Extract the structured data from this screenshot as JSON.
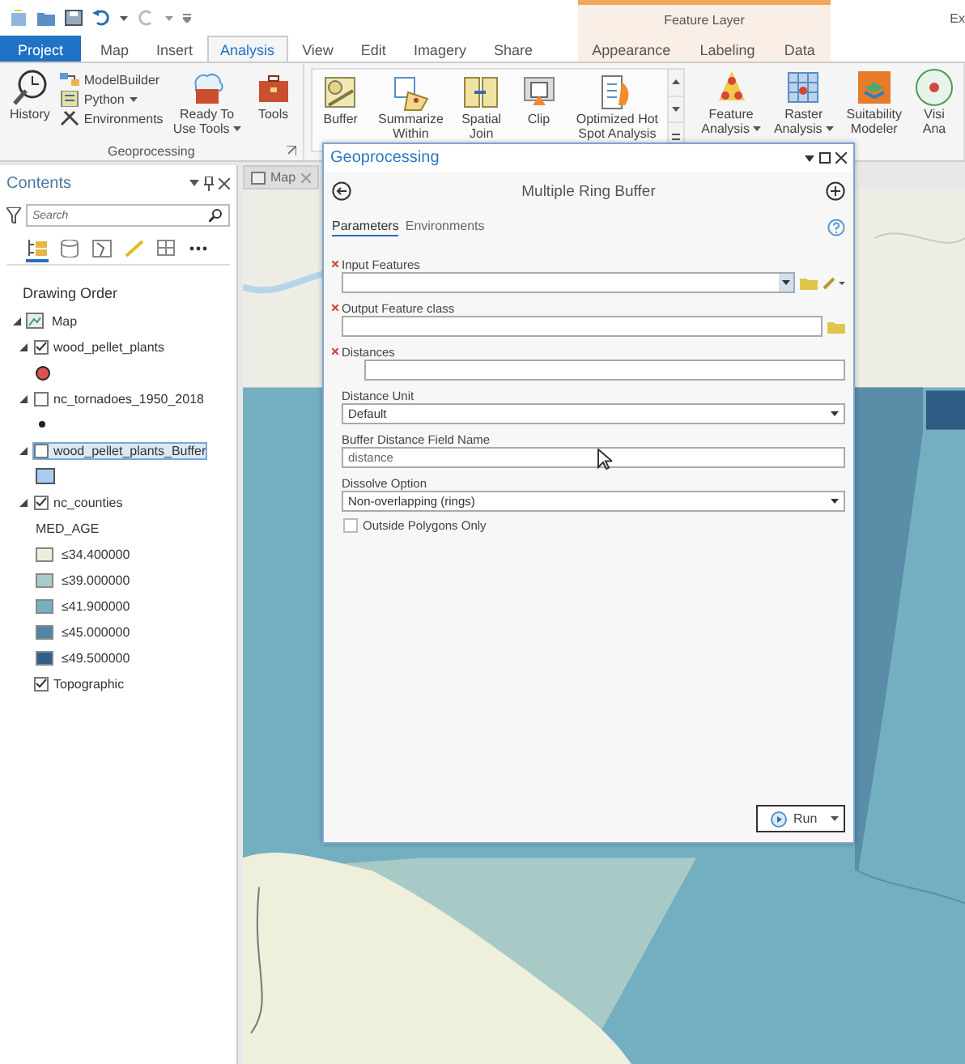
{
  "ribbon": {
    "tabs": [
      {
        "label": "Project",
        "kind": "backstage",
        "selected": false
      },
      {
        "label": "Map",
        "kind": "tab",
        "selected": false
      },
      {
        "label": "Insert",
        "kind": "tab",
        "selected": false
      },
      {
        "label": "Analysis",
        "kind": "tab",
        "selected": true
      },
      {
        "label": "View",
        "kind": "tab",
        "selected": false
      },
      {
        "label": "Edit",
        "kind": "tab",
        "selected": false
      },
      {
        "label": "Imagery",
        "kind": "tab",
        "selected": false
      },
      {
        "label": "Share",
        "kind": "tab",
        "selected": false
      }
    ],
    "contextual": {
      "label": "Feature Layer",
      "tabs": [
        {
          "label": "Appearance",
          "selected": false
        },
        {
          "label": "Labeling",
          "selected": false
        },
        {
          "label": "Data",
          "selected": false
        }
      ]
    },
    "cut_header": "Ex",
    "groups": [
      {
        "label": "Geoprocessing",
        "tools": [
          {
            "kind": "large",
            "lines": [
              "History"
            ]
          },
          {
            "kind": "stack",
            "items": [
              {
                "label": "ModelBuilder"
              },
              {
                "label": "Python",
                "dropdown": true
              },
              {
                "label": "Environments"
              }
            ]
          },
          {
            "kind": "large",
            "lines": [
              "Ready To",
              "Use Tools"
            ],
            "dropdown": true
          },
          {
            "kind": "large",
            "lines": [
              "Tools"
            ]
          }
        ]
      },
      {
        "kind": "gallery",
        "tools": [
          {
            "kind": "large",
            "lines": [
              "Buffer"
            ]
          },
          {
            "kind": "large",
            "lines": [
              "Summarize",
              "Within"
            ]
          },
          {
            "kind": "large",
            "lines": [
              "Spatial",
              "Join"
            ]
          },
          {
            "kind": "large",
            "lines": [
              "Clip"
            ]
          },
          {
            "kind": "large",
            "lines": [
              "Optimized Hot",
              "Spot Analysis"
            ]
          }
        ]
      },
      {
        "tools": [
          {
            "kind": "large",
            "lines": [
              "Feature",
              "Analysis"
            ],
            "dropdown": true
          },
          {
            "kind": "large",
            "lines": [
              "Raster",
              "Analysis"
            ],
            "dropdown": true
          },
          {
            "kind": "large",
            "lines": [
              "Suitability",
              "Modeler"
            ]
          },
          {
            "kind": "large",
            "lines": [
              "Visi",
              "Ana"
            ]
          }
        ]
      }
    ]
  },
  "contents": {
    "title": "Contents",
    "search": {
      "placeholder": "Search"
    },
    "heading": "Drawing Order",
    "tree": [
      {
        "kind": "map",
        "label": "Map",
        "expanded": true,
        "children": [
          {
            "kind": "layer",
            "label": "wood_pellet_plants",
            "expanded": true,
            "checked": true,
            "selected": false,
            "symbol": {
              "kind": "circle"
            }
          },
          {
            "kind": "layer",
            "label": "nc_tornadoes_1950_2018",
            "expanded": true,
            "checked": false,
            "selected": false,
            "symbol": {
              "kind": "dot"
            }
          },
          {
            "kind": "layer",
            "label": "wood_pellet_plants_Buffer",
            "expanded": true,
            "checked": false,
            "selected": true,
            "symbol": {
              "kind": "square"
            }
          },
          {
            "kind": "layer",
            "label": "nc_counties",
            "expanded": true,
            "checked": true,
            "selected": false,
            "field": "MED_AGE",
            "classes": [
              {
                "label": "≤34.400000",
                "color": "#eeeedd"
              },
              {
                "label": "≤39.000000",
                "color": "#a8cbc9"
              },
              {
                "label": "≤41.900000",
                "color": "#74b0be"
              },
              {
                "label": "≤45.000000",
                "color": "#4f87a3"
              },
              {
                "label": "≤49.500000",
                "color": "#2f5f8a"
              }
            ]
          },
          {
            "kind": "layer",
            "label": "Topographic",
            "checked": true,
            "selected": false
          }
        ]
      }
    ]
  },
  "map_tab": {
    "label": "Map"
  },
  "dialog": {
    "title": "Geoprocessing",
    "tool": "Multiple Ring Buffer",
    "tabs": [
      {
        "label": "Parameters",
        "selected": true
      },
      {
        "label": "Environments",
        "selected": false
      }
    ],
    "parameters": [
      {
        "kind": "features",
        "label": "Input Features",
        "required": true
      },
      {
        "kind": "output",
        "label": "Output Feature class",
        "required": true
      },
      {
        "kind": "list",
        "label": "Distances",
        "required": true
      },
      {
        "kind": "select",
        "label": "Distance Unit",
        "required": false,
        "value": "Default"
      },
      {
        "kind": "text",
        "label": "Buffer Distance Field Name",
        "required": false,
        "value": "distance"
      },
      {
        "kind": "select",
        "label": "Dissolve Option",
        "required": false,
        "value": "Non-overlapping (rings)"
      },
      {
        "kind": "checkbox",
        "label": "Outside Polygons Only",
        "checked": false
      }
    ],
    "run": "Run"
  }
}
